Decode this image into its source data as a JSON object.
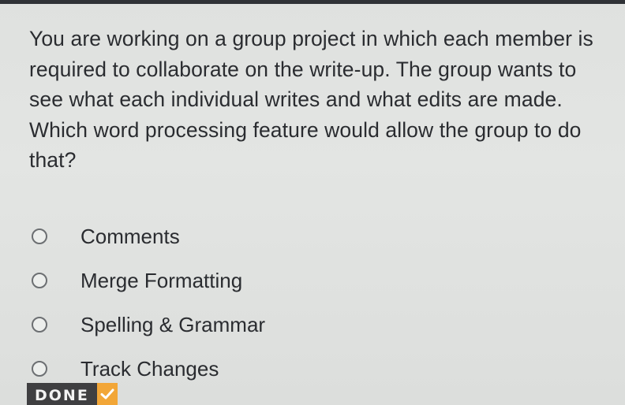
{
  "question": {
    "text": "You are working on a group project in which each member is required to collaborate on the write-up. The group wants to see what each individual writes and what edits are made. Which word processing feature would allow the group to do that?"
  },
  "options": [
    {
      "label": "Comments",
      "selected": false
    },
    {
      "label": "Merge Formatting",
      "selected": false
    },
    {
      "label": "Spelling & Grammar",
      "selected": false
    },
    {
      "label": "Track Changes",
      "selected": false
    }
  ],
  "done_button": {
    "label": "DONE",
    "icon": "checkmark-icon"
  },
  "colors": {
    "done_background": "#3f3f41",
    "done_accent": "#f2a637"
  }
}
